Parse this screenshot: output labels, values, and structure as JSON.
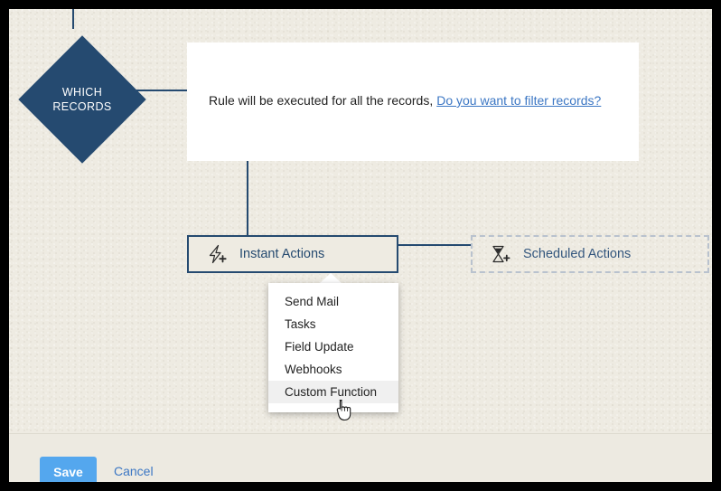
{
  "colors": {
    "navy": "#254a70",
    "canvas": "#eeebe2",
    "link": "#3c77c4",
    "save_button": "#54a7ee",
    "dashed_border": "#b9c2ce",
    "panel": "#ffffff"
  },
  "flow": {
    "decision_node": {
      "line1": "WHICH",
      "line2": "RECORDS"
    },
    "info_panel": {
      "text": "Rule will be executed for all the records,",
      "link_label": "Do you want to filter records?"
    },
    "instant_actions": {
      "label": "Instant Actions",
      "icon": "lightning-bolt-plus-icon"
    },
    "scheduled_actions": {
      "label": "Scheduled Actions",
      "icon": "hourglass-plus-icon"
    }
  },
  "dropdown": {
    "items": [
      {
        "label": "Send Mail",
        "active": false
      },
      {
        "label": "Tasks",
        "active": false
      },
      {
        "label": "Field Update",
        "active": false
      },
      {
        "label": "Webhooks",
        "active": false
      },
      {
        "label": "Custom Function",
        "active": true
      }
    ]
  },
  "footer": {
    "save_label": "Save",
    "cancel_label": "Cancel"
  },
  "cursor": {
    "type": "pointer-hand-cursor"
  }
}
